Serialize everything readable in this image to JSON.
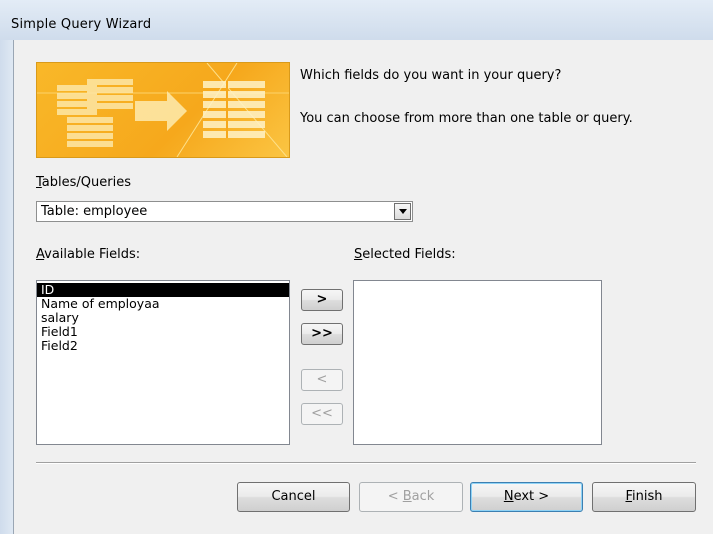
{
  "window": {
    "title": "Simple Query Wizard"
  },
  "instructions": {
    "line1": "Which fields do you want in your query?",
    "line2": "You can choose from more than one table or query."
  },
  "tables_queries": {
    "label_accel": "T",
    "label_rest": "ables/Queries",
    "selected": "Table: employee"
  },
  "available_fields": {
    "label_accel": "A",
    "label_rest": "vailable Fields:",
    "items": [
      "ID",
      "Name of employaa",
      "salary",
      "Field1",
      "Field2"
    ],
    "selected_item": "ID"
  },
  "selected_fields": {
    "label_accel": "S",
    "label_rest": "elected Fields:",
    "items": []
  },
  "move_buttons": {
    "add_one": ">",
    "add_all": ">>",
    "remove_one": "<",
    "remove_all": "<<"
  },
  "footer_buttons": {
    "cancel": "Cancel",
    "back_prefix": "< ",
    "back_accel": "B",
    "back_rest": "ack",
    "next_accel": "N",
    "next_rest": "ext >",
    "finish_accel": "F",
    "finish_rest": "inish"
  },
  "colors": {
    "banner_orange": "#f6a81c",
    "selection": "#000000",
    "default_button_border": "#3c7fb1"
  }
}
